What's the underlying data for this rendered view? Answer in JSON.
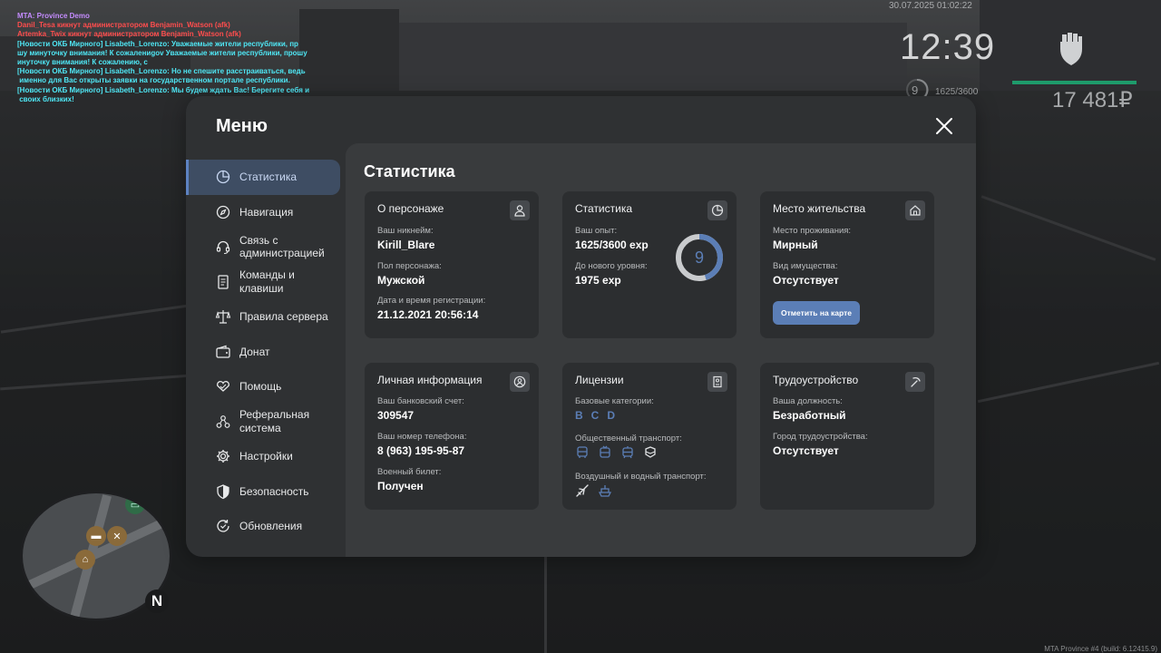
{
  "hud": {
    "datetime": "30.07.2025 01:02:22",
    "clock": "12:39",
    "level": "9",
    "exp": "1625/3600",
    "money": "17 481₽",
    "build": "MTA Province #4 (build: 6.12415.9)"
  },
  "chat": [
    {
      "text": "MTA: Province Demo",
      "color": "purple"
    },
    {
      "text": "Danil_Tesa кикнут администратором Benjamin_Watson (afk)",
      "color": "red"
    },
    {
      "text": "Artemka_Twix кикнут администратором Benjamin_Watson (afk)",
      "color": "red"
    },
    {
      "text": "[Новости ОКБ Мирного] Lisabeth_Lorenzo: Уважаемые жители республики, пр",
      "color": "cyan"
    },
    {
      "text": "шу минуточку внимания! К сожалениgov Уважаемые жители республики, прошу",
      "color": "cyan"
    },
    {
      "text": "инуточку внимания! К сожалению, с",
      "color": "cyan"
    },
    {
      "text": "[Новости ОКБ Мирного] Lisabeth_Lorenzo: Но не спешите расстраиваться, ведь",
      "color": "cyan"
    },
    {
      "text": " именно для Вас открыты заявки на государственном портале республики.",
      "color": "cyan"
    },
    {
      "text": "[Новости ОКБ Мирного] Lisabeth_Lorenzo: Мы будем ждать Вас! Берегите себя и",
      "color": "cyan"
    },
    {
      "text": " своих близких!",
      "color": "cyan"
    }
  ],
  "minimap": {
    "north": "N"
  },
  "menu": {
    "title": "Меню",
    "nav": [
      {
        "label": "Статистика",
        "icon": "pie-chart-icon",
        "active": true
      },
      {
        "label": "Навигация",
        "icon": "compass-icon"
      },
      {
        "label": "Связь с\nадминистрацией",
        "icon": "headset-icon"
      },
      {
        "label": "Команды и\nклавиши",
        "icon": "document-icon"
      },
      {
        "label": "Правила сервера",
        "icon": "scales-icon"
      },
      {
        "label": "Донат",
        "icon": "wallet-icon"
      },
      {
        "label": "Помощь",
        "icon": "heart-hand-icon"
      },
      {
        "label": "Реферальная\nсистема",
        "icon": "referral-icon"
      },
      {
        "label": "Настройки",
        "icon": "gear-icon"
      },
      {
        "label": "Безопасность",
        "icon": "shield-icon"
      },
      {
        "label": "Обновления",
        "icon": "update-icon"
      }
    ]
  },
  "stats": {
    "title": "Статистика",
    "character": {
      "title": "О персонаже",
      "nickname_label": "Ваш никнейм:",
      "nickname": "Kirill_Blare",
      "gender_label": "Пол персонажа:",
      "gender": "Мужской",
      "reg_label": "Дата и время регистрации:",
      "reg": "21.12.2021 20:56:14"
    },
    "statistics": {
      "title": "Статистика",
      "exp_label": "Ваш опыт:",
      "exp": "1625/3600 exp",
      "next_label": "До нового уровня:",
      "next": "1975 exp",
      "level": "9",
      "progress": 0.4514
    },
    "residence": {
      "title": "Место жительства",
      "place_label": "Место проживания:",
      "place": "Мирный",
      "property_label": "Вид имущества:",
      "property": "Отсутствует",
      "button": "Отметить на карте"
    },
    "personal": {
      "title": "Личная информация",
      "bank_label": "Ваш банковский счет:",
      "bank": "309547",
      "phone_label": "Ваш номер телефона:",
      "phone": "8 (963) 195-95-87",
      "military_label": "Военный билет:",
      "military": "Получен"
    },
    "licenses": {
      "title": "Лицензии",
      "base_label": "Базовые категории:",
      "categories": [
        "B",
        "C",
        "D"
      ],
      "public_label": "Общественный транспорт:",
      "air_label": "Воздушный и водный транспорт:"
    },
    "employment": {
      "title": "Трудоустройство",
      "position_label": "Ваша должность:",
      "position": "Безработный",
      "city_label": "Город трудоустройства:",
      "city": "Отсутствует"
    }
  },
  "colors": {
    "accent": "#5b7eb6",
    "money_bar": "#1e9b6b"
  }
}
